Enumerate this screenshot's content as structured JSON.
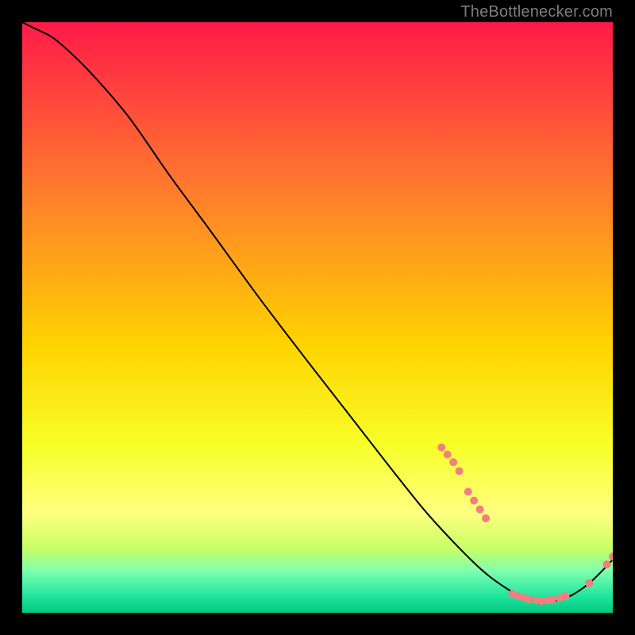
{
  "watermark": "TheBottlenecker.com",
  "colors": {
    "gradient_top": "#ff1a49",
    "gradient_upper_mid": "#ff7a2d",
    "gradient_mid": "#ffd400",
    "gradient_lower_mid": "#f7ff2a",
    "gradient_band1": "#ffff80",
    "gradient_band2": "#c9ff66",
    "gradient_band3": "#7dffb0",
    "gradient_band4": "#23e6a0",
    "gradient_band5": "#00c97f",
    "background": "#000000",
    "line": "#000000",
    "dot": "#f47e7e"
  },
  "chart_data": {
    "type": "line",
    "title": "",
    "xlabel": "",
    "ylabel": "",
    "xlim": [
      0,
      100
    ],
    "ylim": [
      0,
      100
    ],
    "x": [
      0,
      2,
      5,
      8,
      12,
      18,
      25,
      32,
      40,
      48,
      55,
      62,
      68,
      73,
      77,
      80,
      84,
      88,
      92,
      96,
      100
    ],
    "values": [
      100,
      99,
      97.5,
      95,
      91,
      84,
      74,
      64.5,
      53.5,
      43,
      34,
      25,
      17.5,
      12,
      8,
      5.5,
      3,
      2,
      2.5,
      5,
      9
    ],
    "dots": [
      {
        "x": 71,
        "y": 28
      },
      {
        "x": 72,
        "y": 26.8
      },
      {
        "x": 73,
        "y": 25.5
      },
      {
        "x": 74,
        "y": 24
      },
      {
        "x": 75.5,
        "y": 20.5
      },
      {
        "x": 76.5,
        "y": 19
      },
      {
        "x": 77.5,
        "y": 17.5
      },
      {
        "x": 78.5,
        "y": 16
      },
      {
        "x": 83,
        "y": 3.2
      },
      {
        "x": 84,
        "y": 2.8
      },
      {
        "x": 85,
        "y": 2.5
      },
      {
        "x": 85.7,
        "y": 2.3
      },
      {
        "x": 87,
        "y": 2.1
      },
      {
        "x": 88,
        "y": 2.0
      },
      {
        "x": 89,
        "y": 2.1
      },
      {
        "x": 89.7,
        "y": 2.2
      },
      {
        "x": 91,
        "y": 2.5
      },
      {
        "x": 92,
        "y": 2.8
      },
      {
        "x": 96,
        "y": 5.0
      },
      {
        "x": 99,
        "y": 8.2
      },
      {
        "x": 100,
        "y": 9.5
      }
    ]
  }
}
